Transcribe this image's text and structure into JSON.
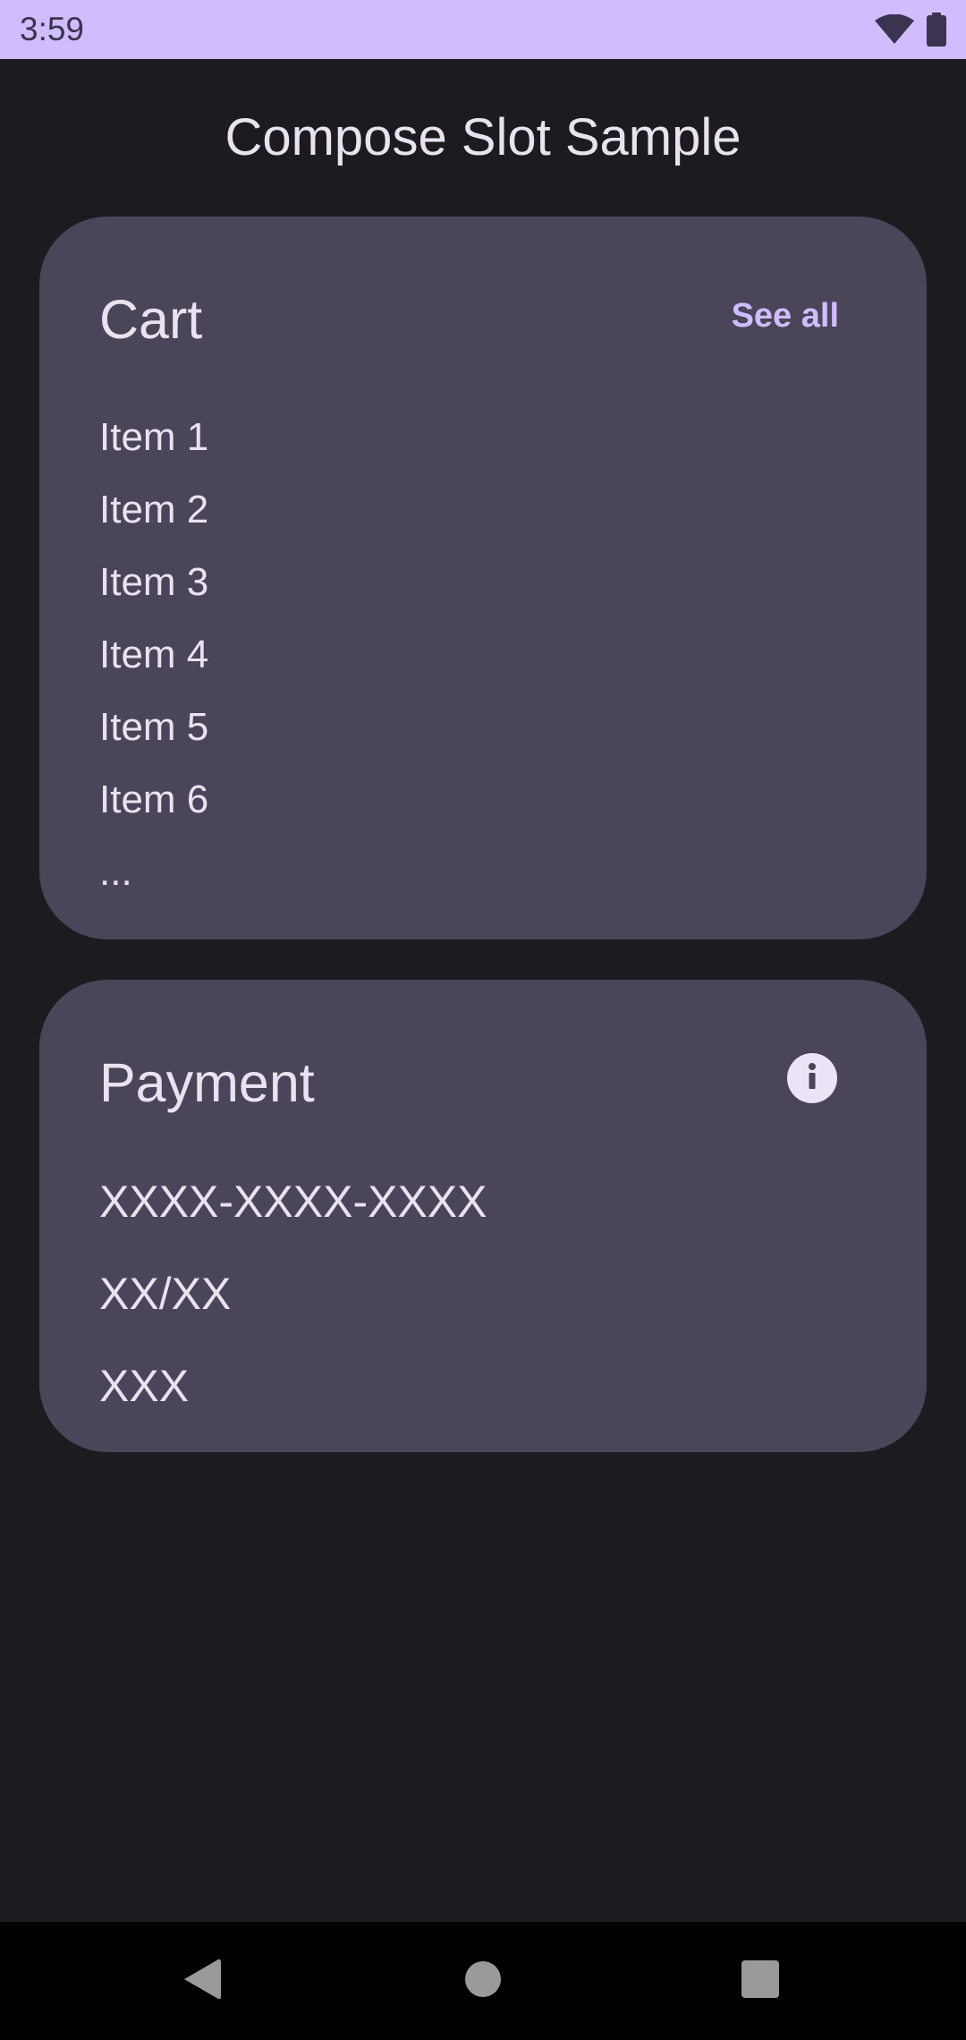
{
  "status_bar": {
    "time": "3:59",
    "icons": [
      "wifi-icon",
      "battery-icon"
    ]
  },
  "app": {
    "title": "Compose Slot Sample"
  },
  "cart": {
    "title": "Cart",
    "see_all_label": "See all",
    "items": [
      "Item 1",
      "Item 2",
      "Item 3",
      "Item 4",
      "Item 5",
      "Item 6",
      "..."
    ]
  },
  "payment": {
    "title": "Payment",
    "info_icon": "info-icon",
    "lines": [
      "XXXX-XXXX-XXXX",
      "XX/XX",
      "XXX"
    ]
  },
  "nav_bar": {
    "buttons": [
      "back-icon",
      "home-icon",
      "recents-icon"
    ]
  },
  "colors": {
    "background": "#1c1b20",
    "status_bar": "#d0bcff",
    "card": "#4a4558",
    "accent": "#d0bcff",
    "text": "#e8e3ee"
  }
}
